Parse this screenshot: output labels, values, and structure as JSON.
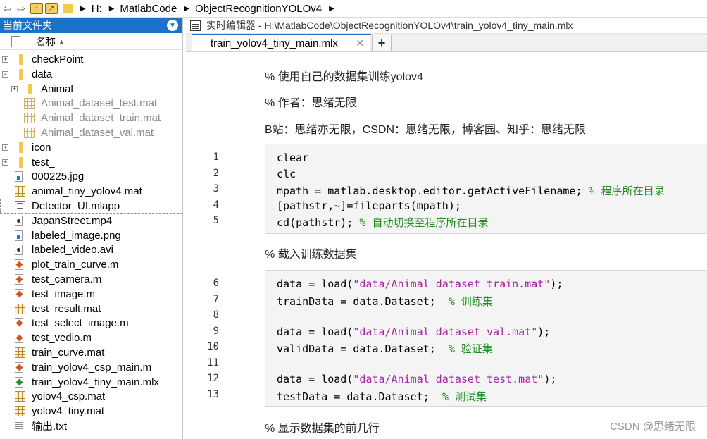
{
  "address_bar": {
    "crumbs": [
      "H:",
      "MatlabCode",
      "ObjectRecognitionYOLOv4"
    ]
  },
  "browser": {
    "title": "当前文件夹",
    "column_name": "名称",
    "items": [
      {
        "label": "checkPoint",
        "type": "folder",
        "expander": "+",
        "depth": 0
      },
      {
        "label": "data",
        "type": "folder",
        "expander": "−",
        "depth": 0
      },
      {
        "label": "Animal",
        "type": "folder",
        "expander": "+",
        "depth": 1
      },
      {
        "label": "Animal_dataset_test.mat",
        "type": "mat-dim",
        "depth": 1,
        "dimmed": true
      },
      {
        "label": "Animal_dataset_train.mat",
        "type": "mat-dim",
        "depth": 1,
        "dimmed": true
      },
      {
        "label": "Animal_dataset_val.mat",
        "type": "mat-dim",
        "depth": 1,
        "dimmed": true
      },
      {
        "label": "icon",
        "type": "folder",
        "expander": "+",
        "depth": 0
      },
      {
        "label": "test_",
        "type": "folder",
        "expander": "+",
        "depth": 0
      },
      {
        "label": "000225.jpg",
        "type": "img",
        "depth": 0
      },
      {
        "label": "animal_tiny_yolov4.mat",
        "type": "mat",
        "depth": 0
      },
      {
        "label": "Detector_UI.mlapp",
        "type": "app",
        "depth": 0,
        "selected": true
      },
      {
        "label": "JapanStreet.mp4",
        "type": "vid",
        "depth": 0
      },
      {
        "label": "labeled_image.png",
        "type": "img",
        "depth": 0
      },
      {
        "label": "labeled_video.avi",
        "type": "vid",
        "depth": 0
      },
      {
        "label": "plot_train_curve.m",
        "type": "m",
        "depth": 0
      },
      {
        "label": "test_camera.m",
        "type": "m",
        "depth": 0
      },
      {
        "label": "test_image.m",
        "type": "m",
        "depth": 0
      },
      {
        "label": "test_result.mat",
        "type": "mat",
        "depth": 0
      },
      {
        "label": "test_select_image.m",
        "type": "m",
        "depth": 0
      },
      {
        "label": "test_vedio.m",
        "type": "m",
        "depth": 0
      },
      {
        "label": "train_curve.mat",
        "type": "mat",
        "depth": 0
      },
      {
        "label": "train_yolov4_csp_main.m",
        "type": "m",
        "depth": 0
      },
      {
        "label": "train_yolov4_tiny_main.mlx",
        "type": "mlx",
        "depth": 0
      },
      {
        "label": "yolov4_csp.mat",
        "type": "mat",
        "depth": 0
      },
      {
        "label": "yolov4_tiny.mat",
        "type": "mat",
        "depth": 0
      },
      {
        "label": "输出.txt",
        "type": "txt",
        "depth": 0
      }
    ]
  },
  "editor": {
    "title": "实时编辑器 - H:\\MatlabCode\\ObjectRecognitionYOLOv4\\train_yolov4_tiny_main.mlx",
    "tab_label": "train_yolov4_tiny_main.mlx",
    "tab_close": "✕",
    "tab_add": "+",
    "text_lines": [
      "% 使用自己的数据集训练yolov4",
      "% 作者：思绪无限",
      "B站：思绪亦无限，CSDN：思绪无限，博客园、知乎：思绪无限",
      "% 载入训练数据集",
      "% 显示数据集的前几行"
    ],
    "code_block_1": [
      {
        "num": "1",
        "parts": [
          {
            "t": "clear",
            "c": ""
          }
        ]
      },
      {
        "num": "2",
        "parts": [
          {
            "t": "clc",
            "c": ""
          }
        ]
      },
      {
        "num": "3",
        "parts": [
          {
            "t": "mpath = matlab.desktop.editor.getActiveFilename; ",
            "c": ""
          },
          {
            "t": "% 程序所在目录",
            "c": "cmt"
          }
        ]
      },
      {
        "num": "4",
        "parts": [
          {
            "t": "[pathstr,~]=fileparts(mpath);",
            "c": ""
          }
        ]
      },
      {
        "num": "5",
        "parts": [
          {
            "t": "cd(pathstr); ",
            "c": ""
          },
          {
            "t": "% 自动切换至程序所在目录",
            "c": "cmt"
          }
        ]
      }
    ],
    "code_block_2": [
      {
        "num": "6",
        "parts": [
          {
            "t": "data = load(",
            "c": ""
          },
          {
            "t": "\"data/Animal_dataset_train.mat\"",
            "c": "str"
          },
          {
            "t": ");",
            "c": ""
          }
        ]
      },
      {
        "num": "7",
        "parts": [
          {
            "t": "trainData = data.Dataset;  ",
            "c": ""
          },
          {
            "t": "% 训练集",
            "c": "cmt"
          }
        ]
      },
      {
        "num": "8",
        "parts": [
          {
            "t": "",
            "c": ""
          }
        ]
      },
      {
        "num": "9",
        "parts": [
          {
            "t": "data = load(",
            "c": ""
          },
          {
            "t": "\"data/Animal_dataset_val.mat\"",
            "c": "str"
          },
          {
            "t": ");",
            "c": ""
          }
        ]
      },
      {
        "num": "10",
        "parts": [
          {
            "t": "validData = data.Dataset;  ",
            "c": ""
          },
          {
            "t": "% 验证集",
            "c": "cmt"
          }
        ]
      },
      {
        "num": "11",
        "parts": [
          {
            "t": "",
            "c": ""
          }
        ]
      },
      {
        "num": "12",
        "parts": [
          {
            "t": "data = load(",
            "c": ""
          },
          {
            "t": "\"data/Animal_dataset_test.mat\"",
            "c": "str"
          },
          {
            "t": ");",
            "c": ""
          }
        ]
      },
      {
        "num": "13",
        "parts": [
          {
            "t": "testData = data.Dataset;  ",
            "c": ""
          },
          {
            "t": "% 测试集",
            "c": "cmt"
          }
        ]
      }
    ]
  },
  "watermark": "CSDN @思绪无限",
  "colors": {
    "accent": "#1a73c9",
    "string": "#a627a4",
    "comment": "#228b22"
  }
}
